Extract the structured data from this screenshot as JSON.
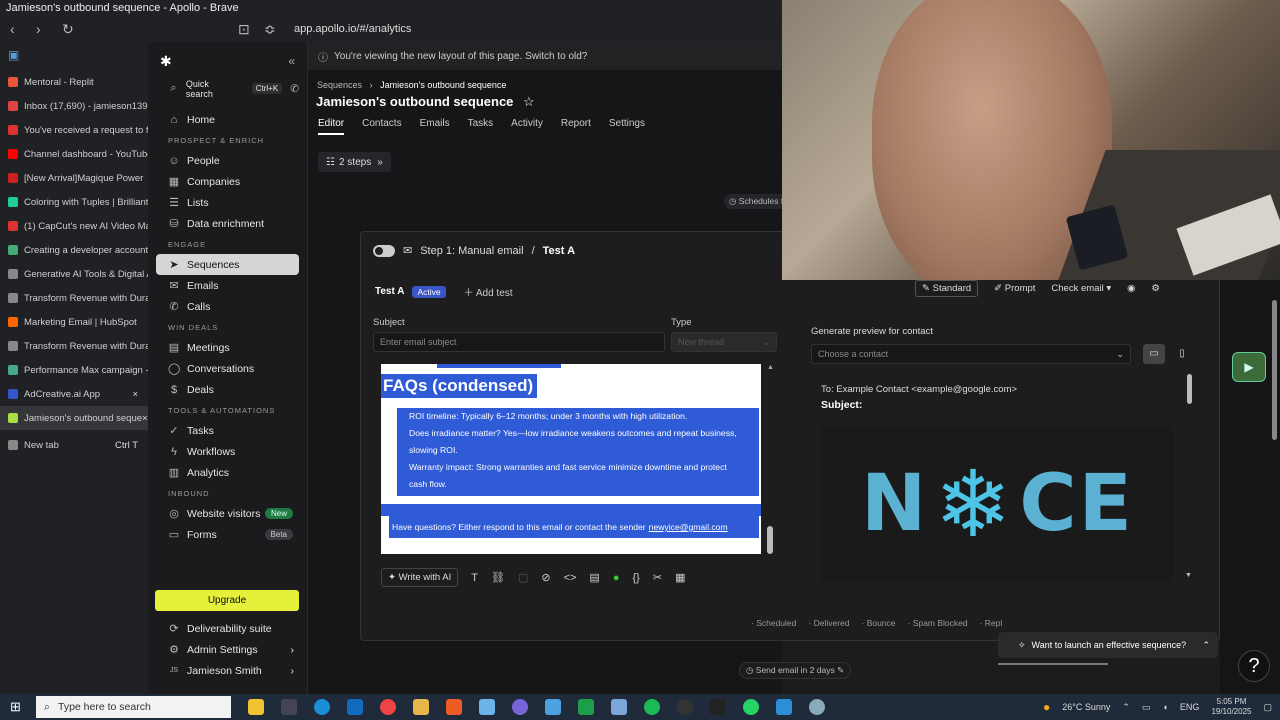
{
  "window": {
    "title": "Jamieson's outbound sequence - Apollo - Brave"
  },
  "addressbar": {
    "url": "app.apollo.io/#/analytics"
  },
  "browser_tabs": [
    {
      "label": "Mentoral - Replit",
      "color": "#e8573a"
    },
    {
      "label": "Inbox (17,690) - jamieson1399",
      "color": "#d44"
    },
    {
      "label": "You've received a request to fi",
      "color": "#d33"
    },
    {
      "label": "Channel dashboard - YouTube",
      "color": "#f00"
    },
    {
      "label": "[New Arrival]Magique Power",
      "color": "#c22"
    },
    {
      "label": "Coloring with Tuples | Brilliant",
      "color": "#2c9"
    },
    {
      "label": "(1) CapCut's new AI Video Mal",
      "color": "#d33"
    },
    {
      "label": "Creating a developer account",
      "color": "#4a7"
    },
    {
      "label": "Generative AI Tools & Digital A",
      "color": "#888"
    },
    {
      "label": "Transform Revenue with Durab",
      "color": "#888"
    },
    {
      "label": "Marketing Email | HubSpot",
      "color": "#f60"
    },
    {
      "label": "Transform Revenue with Durab",
      "color": "#888"
    },
    {
      "label": "Performance Max campaign - T",
      "color": "#4a8"
    },
    {
      "label": "AdCreative.ai App",
      "color": "#35c"
    },
    {
      "label": "Jamieson's outbound seque",
      "color": "#ad4"
    },
    {
      "label": "New tab",
      "color": "#888"
    }
  ],
  "new_tab_shortcut": "Ctrl T",
  "appnav": {
    "quick_search": "Quick search",
    "quick_search_shortcut": "Ctrl+K",
    "home": "Home",
    "sec_prospect": "PROSPECT & ENRICH",
    "people": "People",
    "companies": "Companies",
    "lists": "Lists",
    "data_enrichment": "Data enrichment",
    "sec_engage": "ENGAGE",
    "sequences": "Sequences",
    "emails": "Emails",
    "calls": "Calls",
    "sec_win": "WIN DEALS",
    "meetings": "Meetings",
    "conversations": "Conversations",
    "deals": "Deals",
    "sec_tools": "TOOLS & AUTOMATIONS",
    "tasks": "Tasks",
    "workflows": "Workflows",
    "analytics": "Analytics",
    "sec_inbound": "INBOUND",
    "website_visitors": "Website visitors",
    "badge_new": "New",
    "forms": "Forms",
    "badge_beta": "Beta",
    "upgrade": "Upgrade",
    "deliverability": "Deliverability suite",
    "admin": "Admin Settings",
    "user_initials": "JS",
    "user": "Jamieson Smith"
  },
  "main": {
    "banner": "You're viewing the new layout of this page. Switch to old?",
    "crumb_parent": "Sequences",
    "crumb_current": "Jamieson's outbound sequence",
    "title": "Jamieson's outbound sequence",
    "tabs": [
      "Editor",
      "Contacts",
      "Emails",
      "Tasks",
      "Activity",
      "Report",
      "Settings"
    ],
    "steps_label": "2 steps",
    "schedules_label": "Schedules t"
  },
  "editor": {
    "step_label": "Step 1: Manual email",
    "test_name": "Test A",
    "test_tab": "Test A",
    "status_pill": "Active",
    "add_test": "Add test",
    "subject_label": "Subject",
    "subject_placeholder": "Enter email subject",
    "type_label": "Type",
    "type_value": "New thread",
    "faq_heading": "FAQs (condensed)",
    "faq_lines": [
      "ROI timeline: Typically 6–12 months; under 3 months with high utilization.",
      "Does irradiance matter? Yes—low irradiance weakens outcomes and repeat business,",
      "slowing ROI.",
      "Warranty impact: Strong warranties and fast service minimize downtime and protect",
      "cash flow."
    ],
    "contact_line": "Have questions? Either respond to this email or contact the sender",
    "contact_email": "newyice@gmail.com",
    "write_with_ai": "Write with AI"
  },
  "preview": {
    "standard": "Standard",
    "prompt": "Prompt",
    "check_email": "Check email",
    "generate_label": "Generate preview for contact",
    "contact_placeholder": "Choose a contact",
    "to_line": "To: Example Contact <example@google.com>",
    "subject_line": "Subject:",
    "logo_left": "N",
    "logo_right": "CE"
  },
  "stats": [
    "Scheduled",
    "Delivered",
    "Bounce",
    "Spam Blocked",
    "Repl"
  ],
  "send_in": "Send email in 2 days",
  "launch_prompt": "Want to launch an effective sequence?",
  "taskbar": {
    "search_placeholder": "Type here to search",
    "weather": "26°C  Sunny",
    "lang": "ENG",
    "time": "5:05 PM",
    "date": "19/10/2025"
  }
}
